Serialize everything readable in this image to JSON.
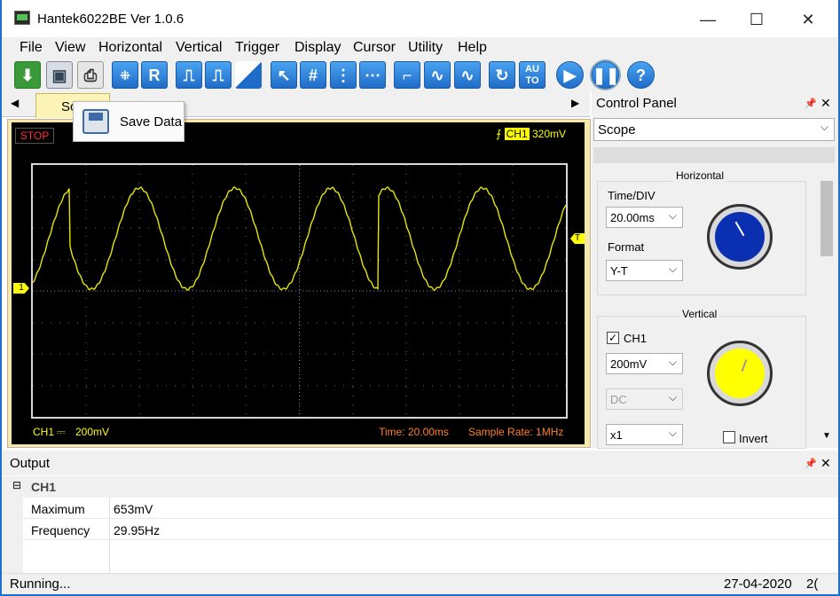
{
  "window": {
    "title": "Hantek6022BE Ver 1.0.6",
    "minimize": "—",
    "maximize": "☐",
    "close": "✕"
  },
  "menu": [
    "File",
    "View",
    "Horizontal",
    "Vertical",
    "Trigger",
    "Display",
    "Cursor",
    "Utility",
    "Help"
  ],
  "toolbar": {
    "r_label": "R",
    "auto_label": "AU TO",
    "help_label": "?"
  },
  "scope_tab": {
    "label": "Scope",
    "prev_arrow": "◀",
    "next_arrow": "▶"
  },
  "popup": {
    "label": "Save Data"
  },
  "scope": {
    "status": "STOP",
    "trigger_channel": "CH1",
    "trigger_level": "320mV",
    "ch1_label": "CH1",
    "coupling_symbol": "⎓",
    "ch1_scale": "200mV",
    "time": "Time: 20.00ms",
    "sample_rate": "Sample Rate: 1MHz",
    "trigger_marker": "T",
    "ch1_marker": "1",
    "waveform_color": "#e6e600"
  },
  "control_panel": {
    "title": "Control Panel",
    "pin": "📌",
    "close": "✕",
    "view_select": "Scope",
    "horizontal": {
      "title": "Horizontal",
      "timediv_label": "Time/DIV",
      "timediv_value": "20.00ms",
      "format_label": "Format",
      "format_value": "Y-T"
    },
    "vertical": {
      "title": "Vertical",
      "ch1_label": "CH1",
      "ch1_checked": true,
      "volts_value": "200mV",
      "coupling_value": "DC",
      "probe_value": "x1",
      "invert_label": "Invert"
    }
  },
  "output": {
    "title": "Output",
    "pin": "📌",
    "close": "✕",
    "group": "CH1",
    "rows": [
      {
        "name": "Maximum",
        "value": "653mV"
      },
      {
        "name": "Frequency",
        "value": "29.95Hz"
      }
    ]
  },
  "status": {
    "text": "Running...",
    "date": "27-04-2020",
    "extra": "2("
  }
}
